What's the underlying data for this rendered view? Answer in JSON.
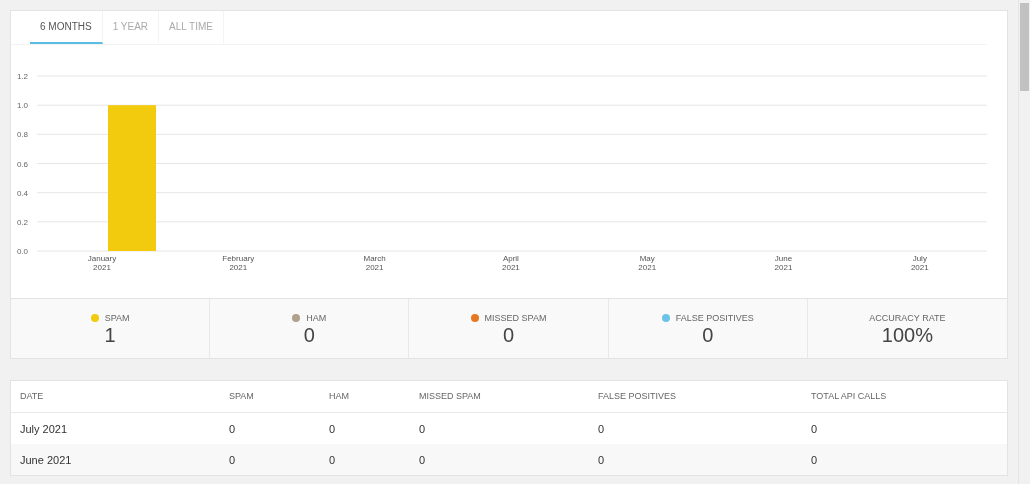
{
  "tabs": [
    {
      "label": "6 MONTHS",
      "selected": true
    },
    {
      "label": "1 YEAR",
      "selected": false
    },
    {
      "label": "ALL TIME",
      "selected": false
    }
  ],
  "chart": {
    "chart_data": {
      "type": "bar",
      "categories": [
        "January\n2021",
        "February\n2021",
        "March\n2021",
        "April\n2021",
        "May\n2021",
        "June\n2021",
        "July\n2021"
      ],
      "series": [
        {
          "color": "#f2cb0f",
          "values": [
            1,
            0,
            0,
            0,
            0,
            0,
            0
          ]
        }
      ],
      "grid": true,
      "ylim": [
        0,
        1.2
      ],
      "yticks": [
        {
          "value": 0,
          "label": "0.0"
        },
        {
          "value": 0.2,
          "label": "0.2"
        },
        {
          "value": 0.4,
          "label": "0.4"
        },
        {
          "value": 0.6,
          "label": "0.6"
        },
        {
          "value": 0.8,
          "label": "0.8"
        },
        {
          "value": 1,
          "label": "1.0"
        },
        {
          "value": 1.2,
          "label": "1.2"
        }
      ]
    }
  },
  "stats": [
    {
      "label": "SPAM",
      "value": "1",
      "color": "#f2cb0f"
    },
    {
      "label": "HAM",
      "value": "0",
      "color": "#b0a18c"
    },
    {
      "label": "MISSED SPAM",
      "value": "0",
      "color": "#e87722"
    },
    {
      "label": "FALSE POSITIVES",
      "value": "0",
      "color": "#6cc3e8"
    },
    {
      "label": "ACCURACY RATE",
      "value": "100%"
    }
  ],
  "table": {
    "columns": [
      "DATE",
      "SPAM",
      "HAM",
      "MISSED SPAM",
      "FALSE POSITIVES",
      "TOTAL API CALLS"
    ],
    "rows": [
      [
        "July 2021",
        "0",
        "0",
        "0",
        "0",
        "0"
      ],
      [
        "June 2021",
        "0",
        "0",
        "0",
        "0",
        "0"
      ]
    ]
  }
}
